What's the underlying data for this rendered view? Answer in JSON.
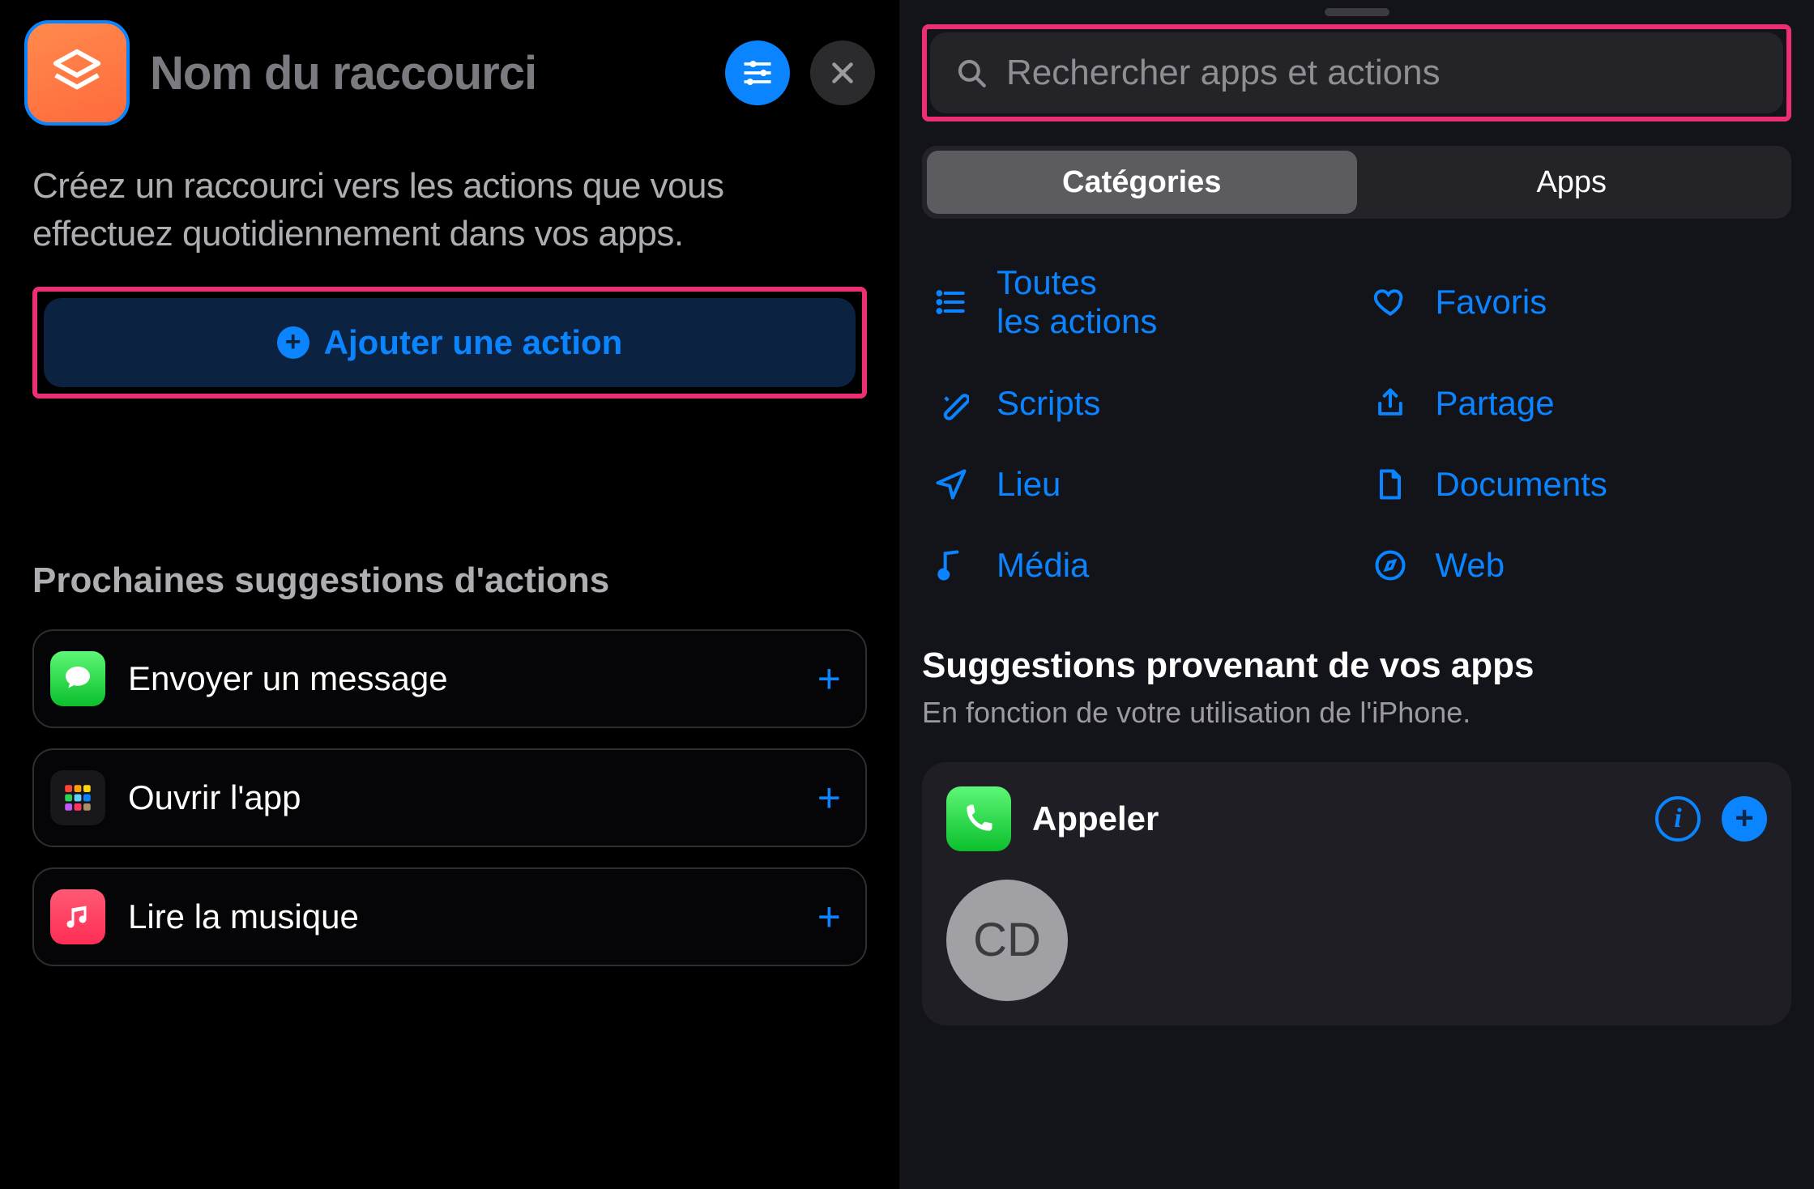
{
  "left": {
    "title_placeholder": "Nom du raccourci",
    "instruction": "Créez un raccourci vers les actions que vous effectuez quotidiennement dans vos apps.",
    "add_action_label": "Ajouter une action",
    "next_suggestions_heading": "Prochaines suggestions d'actions",
    "suggestions": [
      {
        "label": "Envoyer un message",
        "icon": "messages"
      },
      {
        "label": "Ouvrir l'app",
        "icon": "grid"
      },
      {
        "label": "Lire la musique",
        "icon": "music"
      }
    ]
  },
  "right": {
    "search_placeholder": "Rechercher apps et actions",
    "segmented": {
      "categories": "Catégories",
      "apps": "Apps",
      "active": "categories"
    },
    "categories": [
      {
        "id": "all",
        "label": "Toutes\nles actions"
      },
      {
        "id": "favorites",
        "label": "Favoris"
      },
      {
        "id": "scripts",
        "label": "Scripts"
      },
      {
        "id": "share",
        "label": "Partage"
      },
      {
        "id": "location",
        "label": "Lieu"
      },
      {
        "id": "documents",
        "label": "Documents"
      },
      {
        "id": "media",
        "label": "Média"
      },
      {
        "id": "web",
        "label": "Web"
      }
    ],
    "apps_heading": "Suggestions provenant de vos apps",
    "apps_subheading": "En fonction de votre utilisation de l'iPhone.",
    "app_card": {
      "title": "Appeler",
      "contact_initials": "CD"
    }
  },
  "colors": {
    "accent": "#0a84ff",
    "highlight_border": "#ec2e74"
  }
}
